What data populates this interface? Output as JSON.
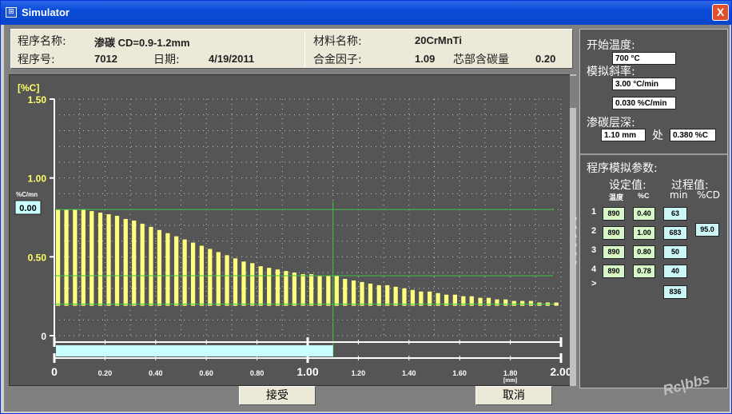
{
  "window": {
    "title": "Simulator",
    "close_glyph": "X",
    "icon": "app-icon"
  },
  "info": {
    "program_name_label": "程序名称:",
    "program_name": "渗碳 CD=0.9-1.2mm",
    "program_no_label": "程序号:",
    "program_no": "7012",
    "date_label": "日期:",
    "date": "4/19/2011",
    "material_label": "材料名称:",
    "material": "20CrMnTi",
    "alloy_label": "合金因子:",
    "alloy": "1.09",
    "core_carbon_label": "芯部含碳量",
    "core_carbon": "0.20"
  },
  "side": {
    "start_temp_label": "开始温度:",
    "start_temp": "700 °C",
    "slope_label": "模拟斜率:",
    "slope_temp": "3.00 °C/min",
    "slope_carbon": "0.030 %C/min",
    "case_depth_label": "渗碳层深:",
    "case_depth": "1.10 mm",
    "at_label": "处",
    "case_carbon": "0.380 %C",
    "params_label": "程序模拟参数:",
    "setpoint_label": "设定值:",
    "process_label": "过程值:",
    "col_temp": "温度",
    "col_carbon": "%C",
    "col_min": "min",
    "col_cd": "%CD",
    "rows": [
      {
        "n": "1",
        "temp": "890",
        "carbon": "0.40",
        "min": "63"
      },
      {
        "n": "2",
        "temp": "890",
        "carbon": "1.00",
        "min": "683"
      },
      {
        "n": "3",
        "temp": "890",
        "carbon": "0.80",
        "min": "50"
      },
      {
        "n": "4",
        "temp": "890",
        "carbon": "0.78",
        "min": "40"
      }
    ],
    "cd_value": "95.0",
    "next_marker": ">",
    "total_min": "836"
  },
  "buttons": {
    "ok": "接受",
    "cancel": "取消"
  },
  "colors": {
    "bar": "#ffff80",
    "grid": "#c8c8c8",
    "ref_line": "#40c040",
    "progress": "#c8ffff",
    "label": "#ffff66"
  },
  "chart_data": {
    "type": "bar",
    "ylabel": "[%C]",
    "xlabel": "[mm]",
    "ylim": [
      0,
      1.5
    ],
    "xlim": [
      0,
      2.0
    ],
    "yticks": [
      0,
      0.5,
      1.0,
      1.5
    ],
    "ytick_labels": [
      "0",
      "0.50",
      "1.00",
      "1.50"
    ],
    "xticks": [
      0,
      0.2,
      0.4,
      0.6,
      0.8,
      1.0,
      1.2,
      1.4,
      1.6,
      1.8,
      2.0
    ],
    "xtick_labels": [
      "0",
      "0.20",
      "0.40",
      "0.60",
      "0.80",
      "1.00",
      "1.20",
      "1.40",
      "1.60",
      "1.80",
      "2.00"
    ],
    "rate_label": "%C/mn",
    "rate_value": "0.00",
    "grid": true,
    "case_depth_marker_x": 1.1,
    "ref_levels": [
      0.8,
      0.38,
      0.2
    ],
    "progress_to_x": 1.1,
    "x": [
      0.0,
      0.033,
      0.067,
      0.1,
      0.133,
      0.167,
      0.2,
      0.233,
      0.267,
      0.3,
      0.333,
      0.367,
      0.4,
      0.433,
      0.467,
      0.5,
      0.533,
      0.567,
      0.6,
      0.633,
      0.667,
      0.7,
      0.733,
      0.767,
      0.8,
      0.833,
      0.867,
      0.9,
      0.933,
      0.967,
      1.0,
      1.033,
      1.067,
      1.1,
      1.133,
      1.167,
      1.2,
      1.233,
      1.267,
      1.3,
      1.333,
      1.367,
      1.4,
      1.433,
      1.467,
      1.5,
      1.533,
      1.567,
      1.6,
      1.633,
      1.667,
      1.7,
      1.733,
      1.767,
      1.8,
      1.833,
      1.867,
      1.9,
      1.933,
      1.967
    ],
    "values": [
      0.8,
      0.8,
      0.8,
      0.8,
      0.79,
      0.78,
      0.77,
      0.76,
      0.74,
      0.73,
      0.71,
      0.69,
      0.67,
      0.65,
      0.63,
      0.61,
      0.59,
      0.57,
      0.55,
      0.53,
      0.51,
      0.49,
      0.47,
      0.46,
      0.44,
      0.43,
      0.42,
      0.41,
      0.4,
      0.39,
      0.39,
      0.38,
      0.38,
      0.38,
      0.36,
      0.35,
      0.34,
      0.33,
      0.32,
      0.32,
      0.31,
      0.3,
      0.29,
      0.28,
      0.28,
      0.27,
      0.26,
      0.26,
      0.25,
      0.25,
      0.24,
      0.24,
      0.23,
      0.23,
      0.22,
      0.22,
      0.22,
      0.21,
      0.21,
      0.21
    ]
  }
}
